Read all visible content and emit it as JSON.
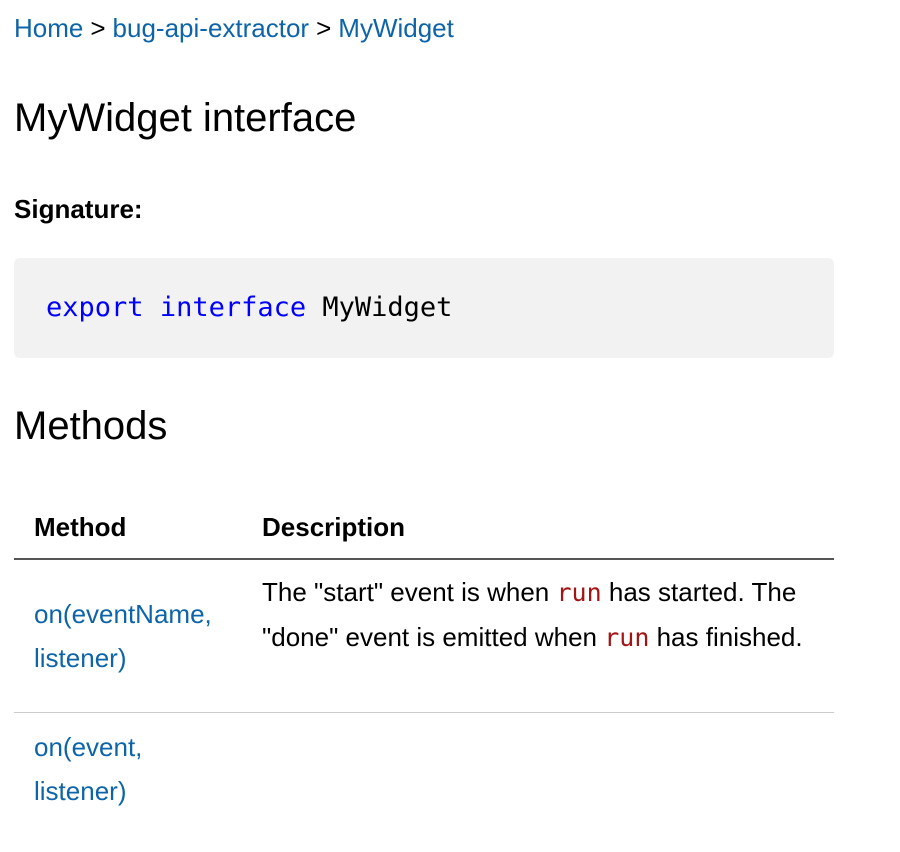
{
  "breadcrumb": {
    "items": [
      "Home",
      "bug-api-extractor",
      "MyWidget"
    ],
    "separator": ">"
  },
  "page_title": "MyWidget interface",
  "signature": {
    "label": "Signature:",
    "code": {
      "keyword1": "export",
      "keyword2": "interface",
      "name": "MyWidget"
    }
  },
  "methods_section": {
    "title": "Methods",
    "headers": {
      "method": "Method",
      "description": "Description"
    },
    "rows": [
      {
        "method": "on(eventName, listener)",
        "description": {
          "part1": "The \"start\" event is when ",
          "code1": "run",
          "part2": " has started. The \"done\" event is emitted when ",
          "code2": "run",
          "part3": " has finished."
        }
      },
      {
        "method": "on(event, listener)",
        "description": {}
      }
    ]
  },
  "colors": {
    "link": "#0e64a8",
    "keyword": "#0000ff",
    "inline_code": "#a31515",
    "code_background": "#f2f2f2"
  }
}
